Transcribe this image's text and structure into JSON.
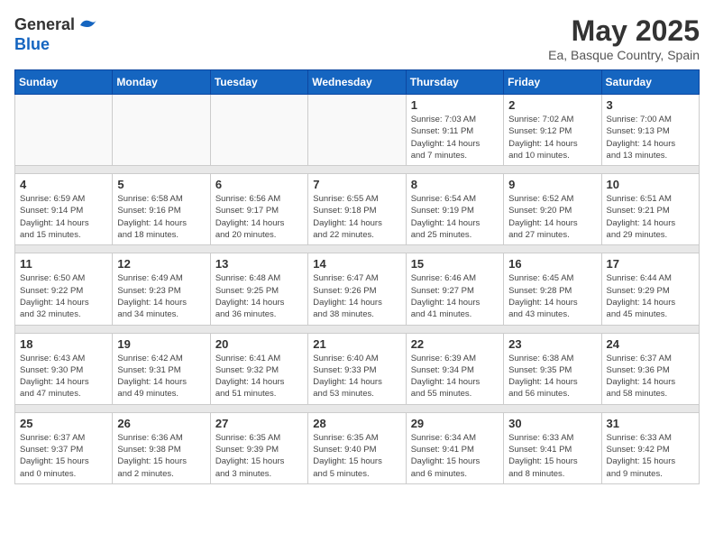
{
  "header": {
    "logo_line1": "General",
    "logo_line2": "Blue",
    "month_title": "May 2025",
    "location": "Ea, Basque Country, Spain"
  },
  "weekdays": [
    "Sunday",
    "Monday",
    "Tuesday",
    "Wednesday",
    "Thursday",
    "Friday",
    "Saturday"
  ],
  "weeks": [
    [
      {
        "day": "",
        "info": ""
      },
      {
        "day": "",
        "info": ""
      },
      {
        "day": "",
        "info": ""
      },
      {
        "day": "",
        "info": ""
      },
      {
        "day": "1",
        "info": "Sunrise: 7:03 AM\nSunset: 9:11 PM\nDaylight: 14 hours\nand 7 minutes."
      },
      {
        "day": "2",
        "info": "Sunrise: 7:02 AM\nSunset: 9:12 PM\nDaylight: 14 hours\nand 10 minutes."
      },
      {
        "day": "3",
        "info": "Sunrise: 7:00 AM\nSunset: 9:13 PM\nDaylight: 14 hours\nand 13 minutes."
      }
    ],
    [
      {
        "day": "4",
        "info": "Sunrise: 6:59 AM\nSunset: 9:14 PM\nDaylight: 14 hours\nand 15 minutes."
      },
      {
        "day": "5",
        "info": "Sunrise: 6:58 AM\nSunset: 9:16 PM\nDaylight: 14 hours\nand 18 minutes."
      },
      {
        "day": "6",
        "info": "Sunrise: 6:56 AM\nSunset: 9:17 PM\nDaylight: 14 hours\nand 20 minutes."
      },
      {
        "day": "7",
        "info": "Sunrise: 6:55 AM\nSunset: 9:18 PM\nDaylight: 14 hours\nand 22 minutes."
      },
      {
        "day": "8",
        "info": "Sunrise: 6:54 AM\nSunset: 9:19 PM\nDaylight: 14 hours\nand 25 minutes."
      },
      {
        "day": "9",
        "info": "Sunrise: 6:52 AM\nSunset: 9:20 PM\nDaylight: 14 hours\nand 27 minutes."
      },
      {
        "day": "10",
        "info": "Sunrise: 6:51 AM\nSunset: 9:21 PM\nDaylight: 14 hours\nand 29 minutes."
      }
    ],
    [
      {
        "day": "11",
        "info": "Sunrise: 6:50 AM\nSunset: 9:22 PM\nDaylight: 14 hours\nand 32 minutes."
      },
      {
        "day": "12",
        "info": "Sunrise: 6:49 AM\nSunset: 9:23 PM\nDaylight: 14 hours\nand 34 minutes."
      },
      {
        "day": "13",
        "info": "Sunrise: 6:48 AM\nSunset: 9:25 PM\nDaylight: 14 hours\nand 36 minutes."
      },
      {
        "day": "14",
        "info": "Sunrise: 6:47 AM\nSunset: 9:26 PM\nDaylight: 14 hours\nand 38 minutes."
      },
      {
        "day": "15",
        "info": "Sunrise: 6:46 AM\nSunset: 9:27 PM\nDaylight: 14 hours\nand 41 minutes."
      },
      {
        "day": "16",
        "info": "Sunrise: 6:45 AM\nSunset: 9:28 PM\nDaylight: 14 hours\nand 43 minutes."
      },
      {
        "day": "17",
        "info": "Sunrise: 6:44 AM\nSunset: 9:29 PM\nDaylight: 14 hours\nand 45 minutes."
      }
    ],
    [
      {
        "day": "18",
        "info": "Sunrise: 6:43 AM\nSunset: 9:30 PM\nDaylight: 14 hours\nand 47 minutes."
      },
      {
        "day": "19",
        "info": "Sunrise: 6:42 AM\nSunset: 9:31 PM\nDaylight: 14 hours\nand 49 minutes."
      },
      {
        "day": "20",
        "info": "Sunrise: 6:41 AM\nSunset: 9:32 PM\nDaylight: 14 hours\nand 51 minutes."
      },
      {
        "day": "21",
        "info": "Sunrise: 6:40 AM\nSunset: 9:33 PM\nDaylight: 14 hours\nand 53 minutes."
      },
      {
        "day": "22",
        "info": "Sunrise: 6:39 AM\nSunset: 9:34 PM\nDaylight: 14 hours\nand 55 minutes."
      },
      {
        "day": "23",
        "info": "Sunrise: 6:38 AM\nSunset: 9:35 PM\nDaylight: 14 hours\nand 56 minutes."
      },
      {
        "day": "24",
        "info": "Sunrise: 6:37 AM\nSunset: 9:36 PM\nDaylight: 14 hours\nand 58 minutes."
      }
    ],
    [
      {
        "day": "25",
        "info": "Sunrise: 6:37 AM\nSunset: 9:37 PM\nDaylight: 15 hours\nand 0 minutes."
      },
      {
        "day": "26",
        "info": "Sunrise: 6:36 AM\nSunset: 9:38 PM\nDaylight: 15 hours\nand 2 minutes."
      },
      {
        "day": "27",
        "info": "Sunrise: 6:35 AM\nSunset: 9:39 PM\nDaylight: 15 hours\nand 3 minutes."
      },
      {
        "day": "28",
        "info": "Sunrise: 6:35 AM\nSunset: 9:40 PM\nDaylight: 15 hours\nand 5 minutes."
      },
      {
        "day": "29",
        "info": "Sunrise: 6:34 AM\nSunset: 9:41 PM\nDaylight: 15 hours\nand 6 minutes."
      },
      {
        "day": "30",
        "info": "Sunrise: 6:33 AM\nSunset: 9:41 PM\nDaylight: 15 hours\nand 8 minutes."
      },
      {
        "day": "31",
        "info": "Sunrise: 6:33 AM\nSunset: 9:42 PM\nDaylight: 15 hours\nand 9 minutes."
      }
    ]
  ]
}
